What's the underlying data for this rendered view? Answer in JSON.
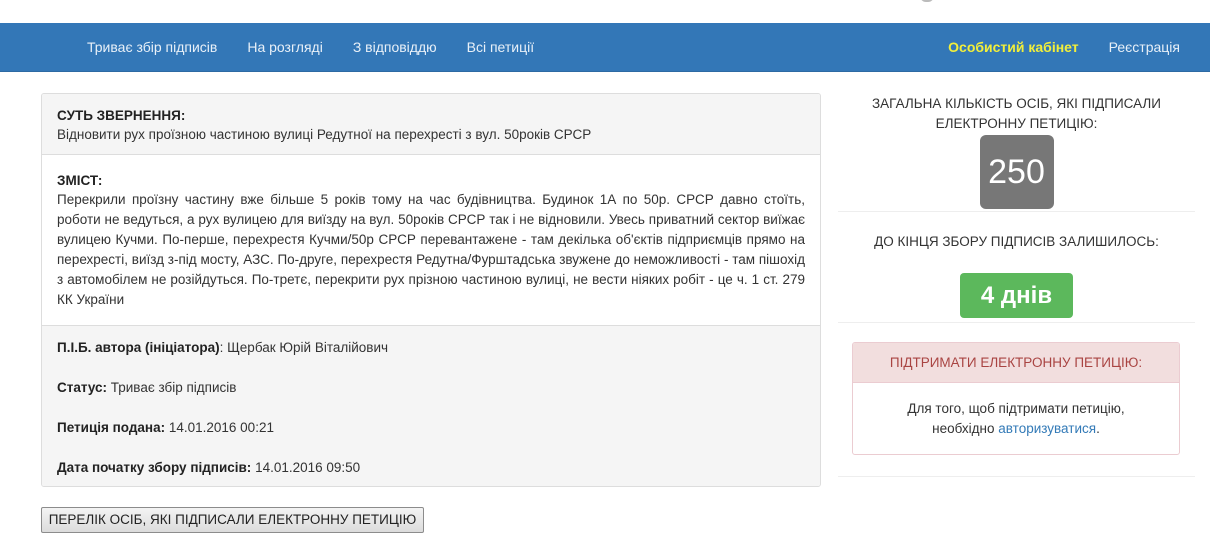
{
  "nav": {
    "left": [
      "Триває збір підписів",
      "На розгляді",
      "З відповіддю",
      "Всі петиції"
    ],
    "cabinet": "Особистий кабінет",
    "register": "Реєстрація"
  },
  "petition": {
    "subject_label": "СУТЬ ЗВЕРНЕННЯ:",
    "subject": "Відновити рух проїзною частиною вулиці Редутної на перехресті з вул. 50років СРСР",
    "content_label": "ЗМІСТ:",
    "content": "Перекрили проїзну частину вже більше 5 років тому на час будівництва. Будинок 1А по 50р. СРСР давно стоїть, роботи не ведуться, а рух вулицею для виїзду на вул. 50років СРСР так і не відновили. Увесь приватний сектор виїжає вулицею Кучми. По-перше, перехрестя Кучми/50р СРСР перевантажене - там декілька об'єктів підприємців прямо на перехресті, виїзд з-під мосту, АЗС. По-друге, перехрестя Редутна/Фурштадська звужене до неможливості - там пішохід з автомобілем не розійдуться. По-третє, перекрити рух прізною частиною вулиці, не вести ніяких робіт - це ч. 1 ст. 279 КК України",
    "author_label": "П.І.Б. автора (ініціатора)",
    "author": "Щербак Юрій Віталійович",
    "status_label": "Статус:",
    "status": "Триває збір підписів",
    "submitted_label": "Петиція подана:",
    "submitted": "14.01.2016 00:21",
    "start_label": "Дата початку збору підписів:",
    "start": "14.01.2016 09:50"
  },
  "list_button": "ПЕРЕЛІК ОСІБ, ЯКІ ПІДПИСАЛИ ЕЛЕКТРОННУ ПЕТИЦІЮ",
  "side": {
    "total_title_1": "ЗАГАЛЬНА КІЛЬКІСТЬ ОСІБ, ЯКІ ПІДПИСАЛИ",
    "total_title_2": "ЕЛЕКТРОННУ ПЕТИЦІЮ:",
    "count": "250",
    "remaining_title": "ДО КІНЦЯ ЗБОРУ ПІДПИСІВ ЗАЛИШИЛОСЬ:",
    "days": "4 днів",
    "support_title": "ПІДТРИМАТИ ЕЛЕКТРОННУ ПЕТИЦІЮ:",
    "support_text_1": "Для того, щоб підтримати петицію,",
    "support_text_2": "необхідно",
    "support_link": "авторизуватися",
    "support_dot": "."
  },
  "colors": {
    "navbar": "#3377b7",
    "accent": "#f2ef3a",
    "count_badge": "#777777",
    "days_badge": "#5cb85c",
    "support_head": "#f2dede"
  }
}
